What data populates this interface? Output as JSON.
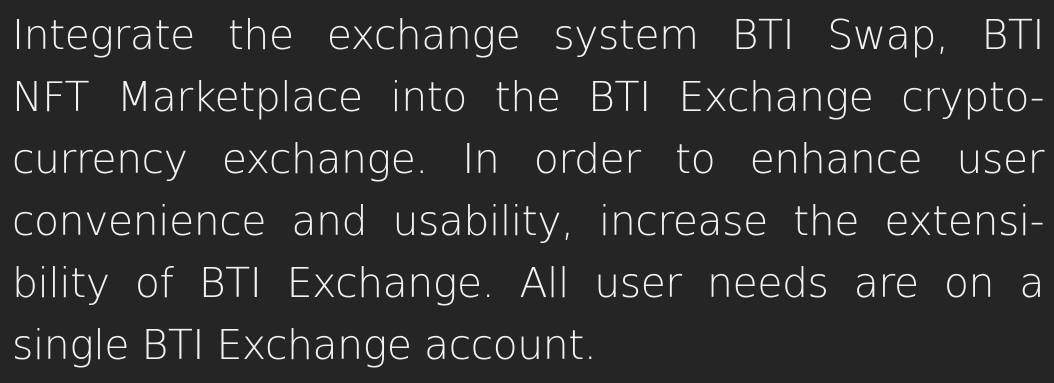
{
  "colors": {
    "background": "#252525",
    "text": "#f2f2f2"
  },
  "paragraph": {
    "lines": [
      "Integrate the exchange system BTI Swap, BTI",
      "NFT Marketplace into the BTI Exchange crypto-",
      "currency exchange. In order to enhance user",
      "convenience and usability, increase the extensi-",
      "bility of BTI Exchange. All user needs are on a",
      "single BTI Exchange account."
    ]
  }
}
